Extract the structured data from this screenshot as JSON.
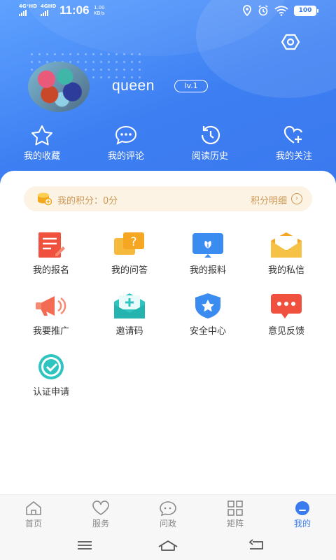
{
  "status_bar": {
    "network1": "4G⁺HD",
    "network2": "4GHD",
    "time": "11:06",
    "speed_value": "1.00",
    "speed_unit": "KB/s",
    "battery": "100"
  },
  "profile": {
    "username": "queen",
    "level": "lv.1"
  },
  "quick_actions": [
    {
      "label": "我的收藏",
      "icon": "star-icon"
    },
    {
      "label": "我的评论",
      "icon": "comment-icon"
    },
    {
      "label": "阅读历史",
      "icon": "history-icon"
    },
    {
      "label": "我的关注",
      "icon": "heart-plus-icon"
    }
  ],
  "points": {
    "label": "我的积分：",
    "value": "0分",
    "detail_link": "积分明细",
    "arrow": "›"
  },
  "services": [
    {
      "label": "我的报名",
      "icon": "signup-icon",
      "color": "#f0513f"
    },
    {
      "label": "我的问答",
      "icon": "qa-icon",
      "color": "#f5a623"
    },
    {
      "label": "我的报料",
      "icon": "report-icon",
      "color": "#3b8cf0"
    },
    {
      "label": "我的私信",
      "icon": "mail-icon",
      "color": "#f6b93b"
    },
    {
      "label": "我要推广",
      "icon": "megaphone-icon",
      "color": "#f46b53"
    },
    {
      "label": "邀请码",
      "icon": "invite-icon",
      "color": "#2ec5c0"
    },
    {
      "label": "安全中心",
      "icon": "shield-icon",
      "color": "#3b8cf0"
    },
    {
      "label": "意见反馈",
      "icon": "feedback-icon",
      "color": "#f0513f"
    },
    {
      "label": "认证申请",
      "icon": "certify-icon",
      "color": "#2ec5c0"
    }
  ],
  "tabbar": [
    {
      "label": "首页",
      "icon": "home-icon",
      "active": false
    },
    {
      "label": "服务",
      "icon": "heart-icon",
      "active": false
    },
    {
      "label": "问政",
      "icon": "chat-icon",
      "active": false
    },
    {
      "label": "矩阵",
      "icon": "grid-icon",
      "active": false
    },
    {
      "label": "我的",
      "icon": "user-icon",
      "active": true
    }
  ],
  "colors": {
    "header": "#3d7ff2",
    "accent": "#3a7cf0",
    "points_bg": "#fdf3e4",
    "points_text": "#cc9752"
  }
}
